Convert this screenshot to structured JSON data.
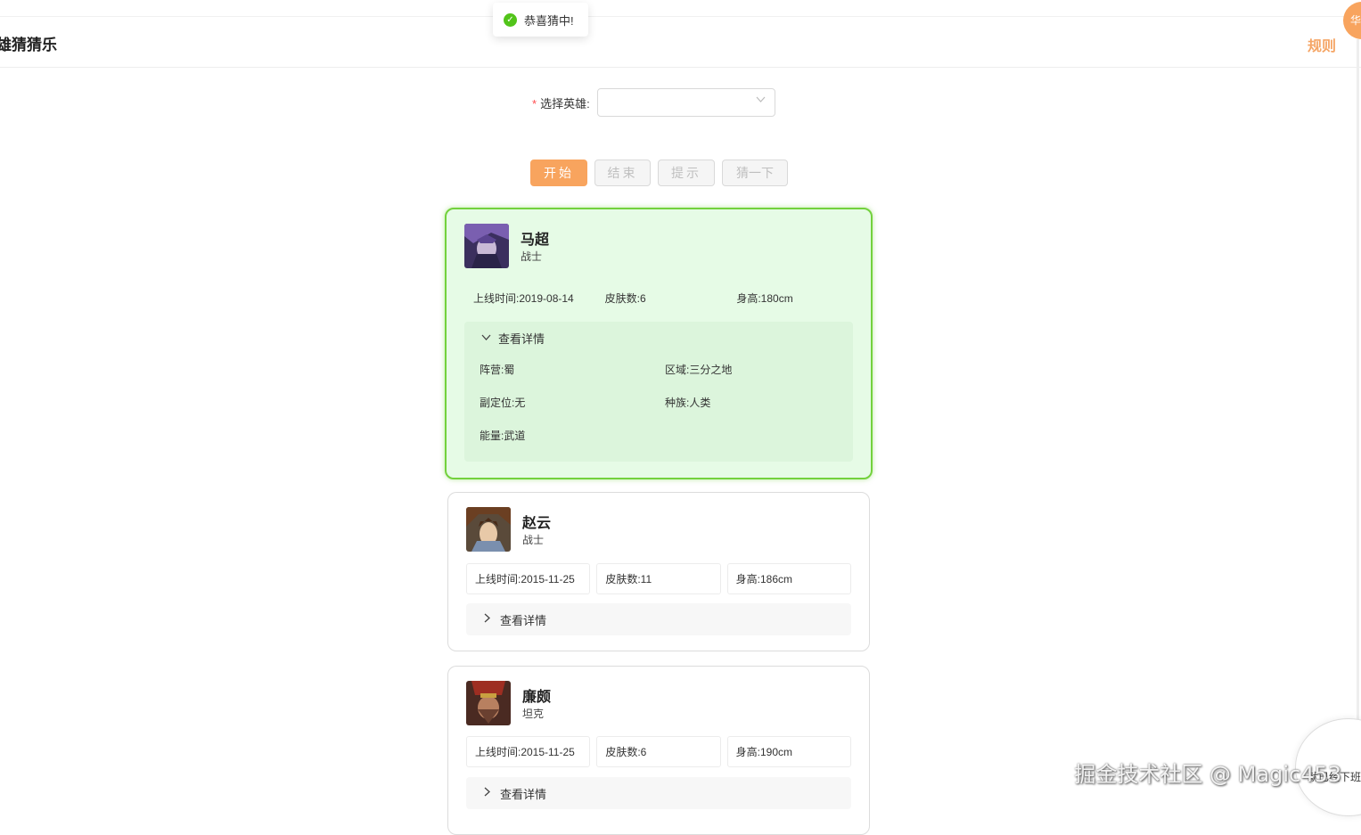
{
  "header": {
    "title": "雄猜猜乐",
    "rules_link": "规则",
    "user_initial": "华"
  },
  "toast": {
    "message": "恭喜猜中!"
  },
  "form": {
    "required_mark": "*",
    "hero_label": "选择英雄:",
    "hero_value": ""
  },
  "buttons": {
    "start": "开始",
    "end": "结束",
    "hint": "提示",
    "guess": "猜一下"
  },
  "heroes": [
    {
      "name": "马超",
      "role": "战士",
      "release": "上线时间:2019-08-14",
      "skins": "皮肤数:6",
      "height": "身高:180cm",
      "details_label": "查看详情",
      "expanded": true,
      "correct": true,
      "details": {
        "faction": "阵营:蜀",
        "region": "区域:三分之地",
        "sub_role": "副定位:无",
        "race": "种族:人类",
        "energy": "能量:武道"
      }
    },
    {
      "name": "赵云",
      "role": "战士",
      "release": "上线时间:2015-11-25",
      "skins": "皮肤数:11",
      "height": "身高:186cm",
      "details_label": "查看详情",
      "expanded": false,
      "correct": false
    },
    {
      "name": "廉颇",
      "role": "坦克",
      "release": "上线时间:2015-11-25",
      "skins": "皮肤数:6",
      "height": "身高:190cm",
      "details_label": "查看详情",
      "expanded": false,
      "correct": false
    }
  ],
  "watermark": "掘金技术社区 @ Magic453",
  "float_text": "就已经下班",
  "colors": {
    "accent": "#f8a45e",
    "success": "#52c41a",
    "win_border": "#73d13d",
    "win_bg": "#e6fbe6"
  }
}
